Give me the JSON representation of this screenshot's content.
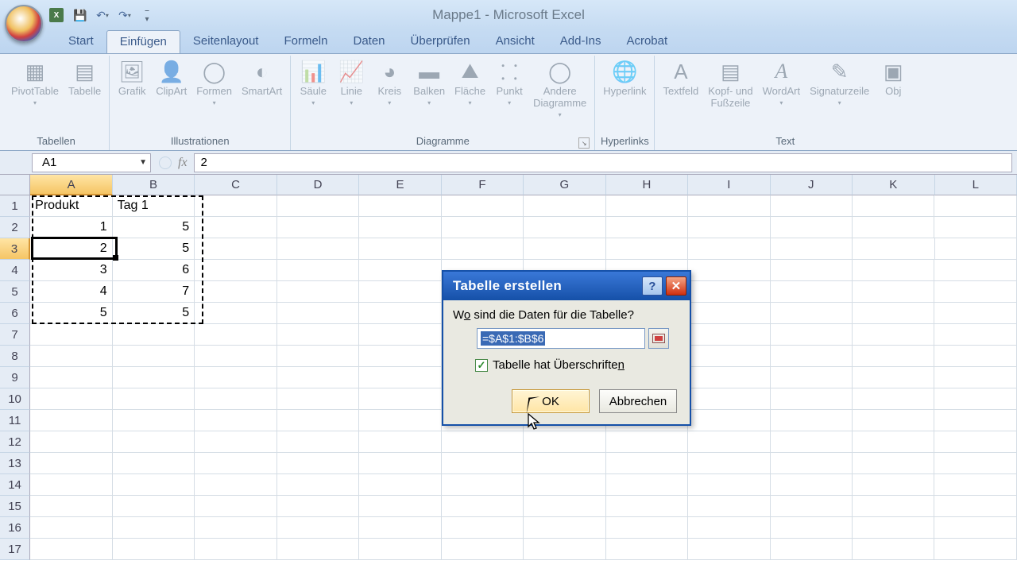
{
  "app": {
    "title": "Mappe1 - Microsoft Excel"
  },
  "ribbon": {
    "tabs": [
      "Start",
      "Einfügen",
      "Seitenlayout",
      "Formeln",
      "Daten",
      "Überprüfen",
      "Ansicht",
      "Add-Ins",
      "Acrobat"
    ],
    "active_tab": "Einfügen",
    "groups": {
      "tabellen": {
        "label": "Tabellen",
        "items": [
          "PivotTable",
          "Tabelle"
        ]
      },
      "illustrationen": {
        "label": "Illustrationen",
        "items": [
          "Grafik",
          "ClipArt",
          "Formen",
          "SmartArt"
        ]
      },
      "diagramme": {
        "label": "Diagramme",
        "items": [
          "Säule",
          "Linie",
          "Kreis",
          "Balken",
          "Fläche",
          "Punkt",
          "Andere\nDiagramme"
        ]
      },
      "hyperlinks": {
        "label": "Hyperlinks",
        "items": [
          "Hyperlink"
        ]
      },
      "text": {
        "label": "Text",
        "items": [
          "Textfeld",
          "Kopf- und\nFußzeile",
          "WordArt",
          "Signaturzeile",
          "Obj"
        ]
      }
    }
  },
  "name_box": {
    "value": "A1"
  },
  "formula_bar": {
    "fx": "fx",
    "value": "2"
  },
  "grid": {
    "columns": [
      "A",
      "B",
      "C",
      "D",
      "E",
      "F",
      "G",
      "H",
      "I",
      "J",
      "K",
      "L"
    ],
    "rows": 17,
    "selected_col": 0,
    "selected_row": 2,
    "headers": [
      {
        "r": 0,
        "c": 0,
        "v": "Produkt",
        "align": "left"
      },
      {
        "r": 0,
        "c": 1,
        "v": "Tag 1",
        "align": "left"
      }
    ],
    "data": [
      {
        "r": 1,
        "c": 0,
        "v": "1"
      },
      {
        "r": 1,
        "c": 1,
        "v": "5"
      },
      {
        "r": 2,
        "c": 0,
        "v": "2"
      },
      {
        "r": 2,
        "c": 1,
        "v": "5"
      },
      {
        "r": 3,
        "c": 0,
        "v": "3"
      },
      {
        "r": 3,
        "c": 1,
        "v": "6"
      },
      {
        "r": 4,
        "c": 0,
        "v": "4"
      },
      {
        "r": 4,
        "c": 1,
        "v": "7"
      },
      {
        "r": 5,
        "c": 0,
        "v": "5"
      },
      {
        "r": 5,
        "c": 1,
        "v": "5"
      }
    ]
  },
  "dialog": {
    "title": "Tabelle erstellen",
    "prompt_pre": "W",
    "prompt_underline": "o",
    "prompt_post": " sind die Daten für die Tabelle?",
    "range": "=$A$1:$B$6",
    "checkbox_label": "Tabelle hat Überschrifte",
    "checkbox_underline": "n",
    "checked": true,
    "ok": "OK",
    "cancel": "Abbrechen"
  }
}
